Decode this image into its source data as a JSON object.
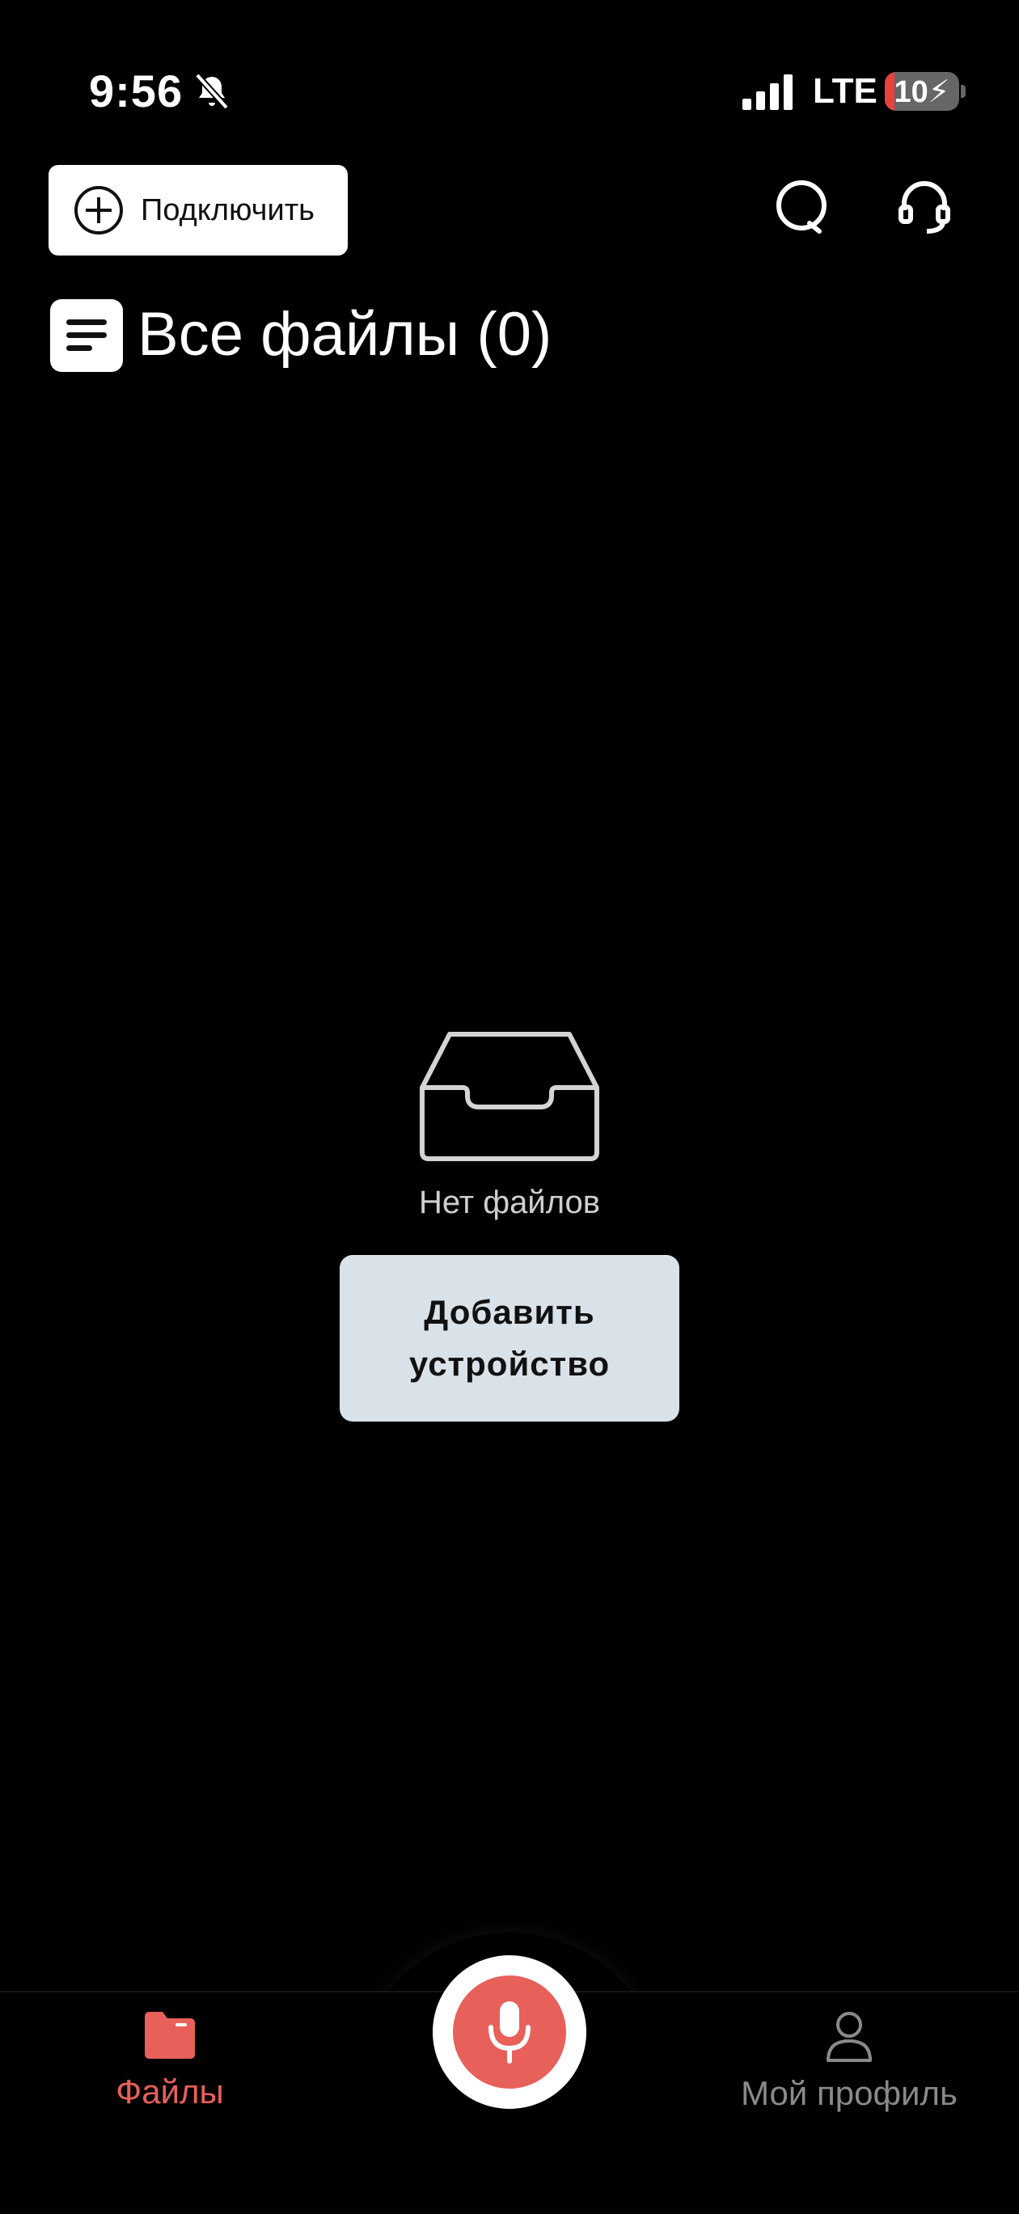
{
  "status_bar": {
    "time": "9:56",
    "network": "LTE",
    "battery": "10"
  },
  "header": {
    "connect_label": "Подключить"
  },
  "page": {
    "title": "Все файлы (0)"
  },
  "empty_state": {
    "message": "Нет файлов",
    "add_device_label": "Добавить устройство"
  },
  "bottom_nav": {
    "files_label": "Файлы",
    "profile_label": "Мой профиль",
    "active": "files"
  },
  "colors": {
    "accent": "#e8605a",
    "button_bg": "#d9e2e8",
    "battery_low": "#e8423d"
  },
  "icons": [
    "bell-muted-icon",
    "signal-icon",
    "plus-circle-icon",
    "search-icon",
    "headset-icon",
    "list-icon",
    "inbox-tray-icon",
    "folder-icon",
    "microphone-icon",
    "user-icon"
  ]
}
